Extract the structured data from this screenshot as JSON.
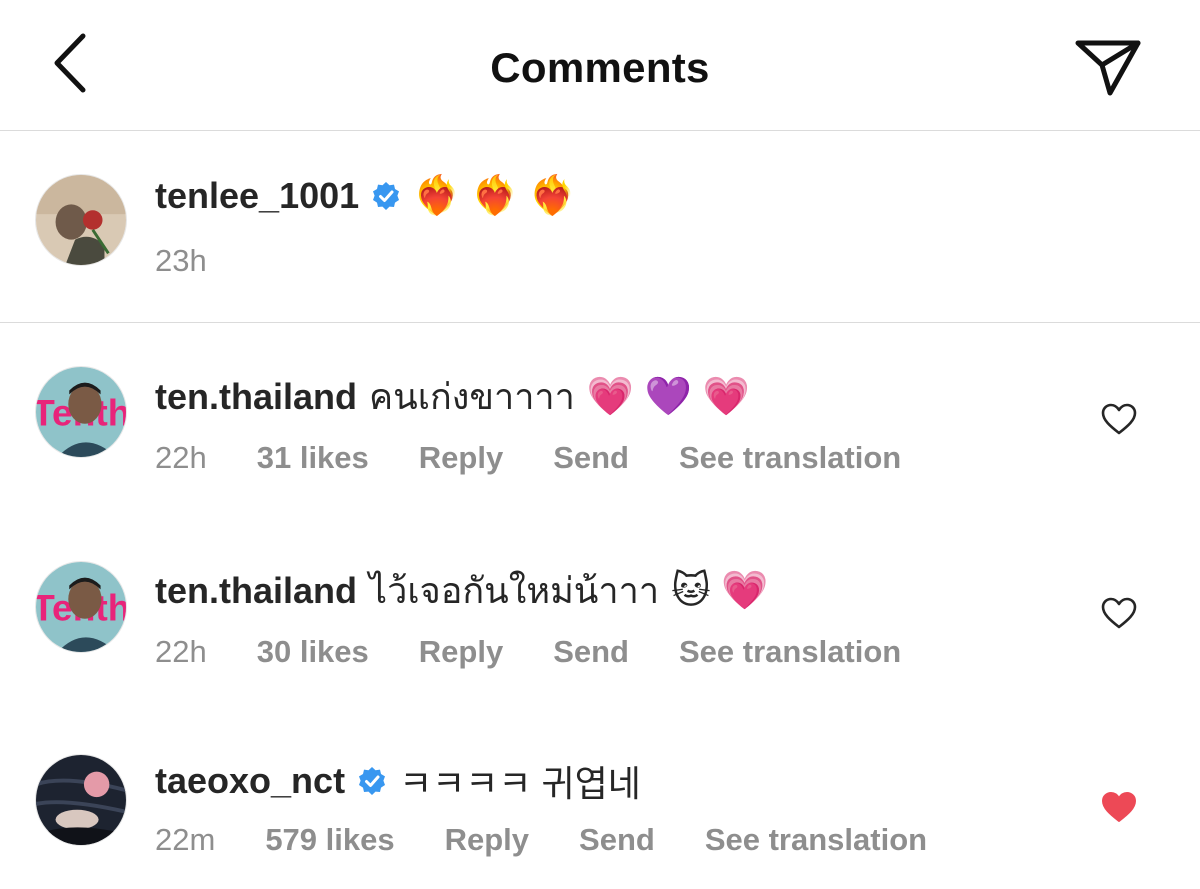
{
  "header": {
    "title": "Comments"
  },
  "caption": {
    "username": "tenlee_1001",
    "verified": true,
    "emojis": "❤️‍🔥 ❤️‍🔥 ❤️‍🔥",
    "time": "23h"
  },
  "comments": [
    {
      "username": "ten.thailand",
      "verified": false,
      "text": "คนเก่งขาาาา",
      "emojis": "💗 💜 💗",
      "time": "22h",
      "likes": "31 likes",
      "reply": "Reply",
      "send": "Send",
      "translate": "See translation",
      "liked": false
    },
    {
      "username": "ten.thailand",
      "verified": false,
      "text": "ไว้เจอกันใหม่น้าาา",
      "emojis": "🐱 💗",
      "time": "22h",
      "likes": "30 likes",
      "reply": "Reply",
      "send": "Send",
      "translate": "See translation",
      "liked": false
    },
    {
      "username": "taeoxo_nct",
      "verified": true,
      "text": "ㅋㅋㅋㅋ 귀엽네",
      "emojis": "",
      "time": "22m",
      "likes": "579 likes",
      "reply": "Reply",
      "send": "Send",
      "translate": "See translation",
      "liked": true
    }
  ],
  "colors": {
    "verified_blue": "#3897f0",
    "liked_red": "#ed4956",
    "meta_gray": "#8e8e8e"
  }
}
